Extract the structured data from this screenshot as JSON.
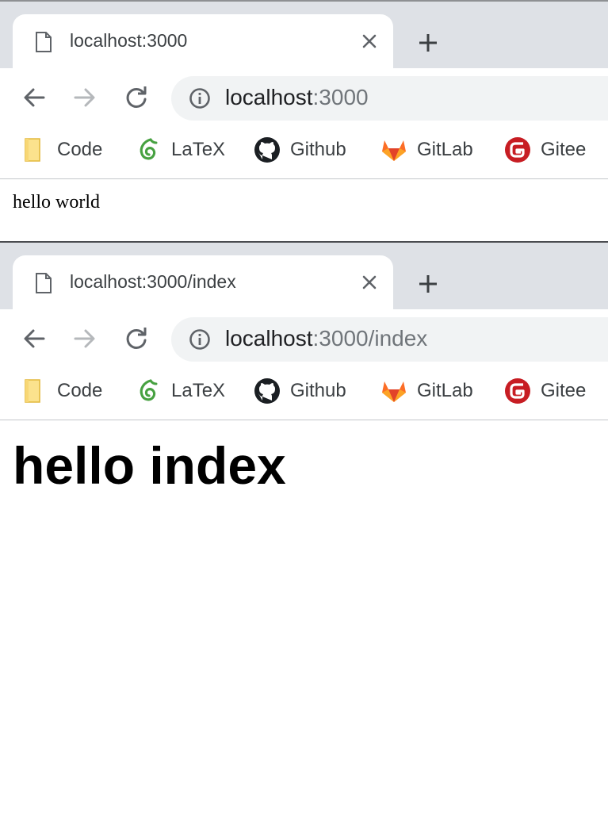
{
  "windows": [
    {
      "tab_title": "localhost:3000",
      "url_host": "localhost",
      "url_rest": ":3000",
      "content_text": "hello world"
    },
    {
      "tab_title": "localhost:3000/index",
      "url_host": "localhost",
      "url_rest": ":3000/index",
      "content_heading": "hello index"
    }
  ],
  "bookmarks": {
    "code": "Code",
    "latex": "LaTeX",
    "github": "Github",
    "gitlab": "GitLab",
    "gitee": "Gitee"
  },
  "icons": {
    "page": "page-icon",
    "close": "close-icon",
    "new_tab": "plus-icon",
    "back": "arrow-left-icon",
    "forward": "arrow-right-icon",
    "reload": "reload-icon",
    "info": "info-icon",
    "code": "folder-icon",
    "latex": "overleaf-leaf-icon",
    "github": "github-icon",
    "gitlab": "gitlab-fox-icon",
    "gitee": "gitee-icon"
  },
  "colors": {
    "tabstrip_bg": "#dee1e6",
    "omnibox_bg": "#f1f3f4",
    "text_dark": "#3c4043",
    "url_muted": "#70757a",
    "overleaf_green": "#47a141",
    "gitlab_orange": "#e24329",
    "gitee_red": "#c71d23",
    "folder_yellow": "#f8d775"
  }
}
